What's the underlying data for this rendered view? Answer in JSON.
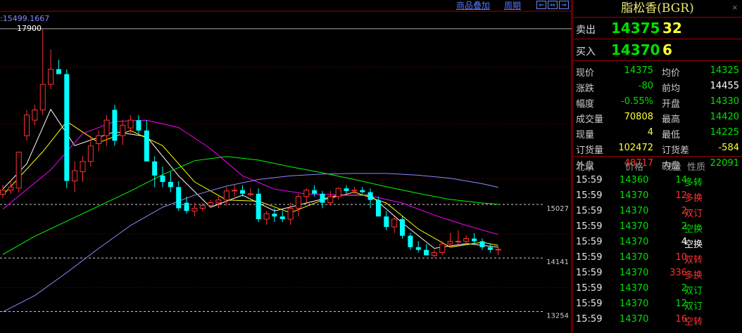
{
  "colors": {
    "up": "#ff3232",
    "down": "#00ffff",
    "gain": "#00e000",
    "loss": "#ff3232",
    "neutral": "#ffffff",
    "ma5": "#ffffff",
    "ma10": "#ffff00",
    "ma20": "#ff00ff",
    "ma40": "#00ff00",
    "ma60": "#8a8aff"
  },
  "toolbar": {
    "overlay_label": "商品叠加",
    "period_label": "周期",
    "nav_left": "⇐",
    "nav_mid": "⇔",
    "nav_right": "⇒"
  },
  "chart": {
    "top_readout": ":15499.1667",
    "high_label": "17900",
    "ref_lines": [
      {
        "label": "15027",
        "value": 15027
      },
      {
        "label": "14141",
        "value": 14141
      },
      {
        "label": "13254",
        "value": 13254
      }
    ]
  },
  "chart_data": {
    "type": "candlestick",
    "ylim": [
      12900,
      18200
    ],
    "candles": [
      {
        "o": 15195,
        "h": 15348,
        "l": 15127,
        "c": 15263
      },
      {
        "o": 15263,
        "h": 15432,
        "l": 15195,
        "c": 15314
      },
      {
        "o": 15297,
        "h": 15824,
        "l": 15229,
        "c": 15892
      },
      {
        "o": 16165,
        "h": 16591,
        "l": 16080,
        "c": 16506
      },
      {
        "o": 16421,
        "h": 16677,
        "l": 16336,
        "c": 16591
      },
      {
        "o": 16591,
        "h": 17934,
        "l": 16506,
        "c": 17014
      },
      {
        "o": 17014,
        "h": 17592,
        "l": 16932,
        "c": 17265
      },
      {
        "o": 17265,
        "h": 17421,
        "l": 17183,
        "c": 17183
      },
      {
        "o": 17183,
        "h": 17265,
        "l": 15297,
        "c": 15416
      },
      {
        "o": 15416,
        "h": 15739,
        "l": 15229,
        "c": 15586
      },
      {
        "o": 15568,
        "h": 15824,
        "l": 15399,
        "c": 15739
      },
      {
        "o": 15739,
        "h": 16165,
        "l": 15654,
        "c": 15995
      },
      {
        "o": 16033,
        "h": 16250,
        "l": 15908,
        "c": 16165
      },
      {
        "o": 16165,
        "h": 16506,
        "l": 15995,
        "c": 16421
      },
      {
        "o": 16592,
        "h": 16677,
        "l": 15995,
        "c": 16080
      },
      {
        "o": 16165,
        "h": 16421,
        "l": 16012,
        "c": 16336
      },
      {
        "o": 16293,
        "h": 16506,
        "l": 16210,
        "c": 16421
      },
      {
        "o": 16421,
        "h": 16506,
        "l": 16200,
        "c": 16250
      },
      {
        "o": 16250,
        "h": 16421,
        "l": 15739,
        "c": 15739
      },
      {
        "o": 15739,
        "h": 15824,
        "l": 15314,
        "c": 15505
      },
      {
        "o": 15505,
        "h": 15654,
        "l": 15314,
        "c": 15399
      },
      {
        "o": 15399,
        "h": 15568,
        "l": 15229,
        "c": 15314
      },
      {
        "o": 15314,
        "h": 15414,
        "l": 14919,
        "c": 14964
      },
      {
        "o": 15055,
        "h": 15158,
        "l": 14873,
        "c": 14919
      },
      {
        "o": 14919,
        "h": 15055,
        "l": 14828,
        "c": 14964
      },
      {
        "o": 14964,
        "h": 15055,
        "l": 14919,
        "c": 15010
      },
      {
        "o": 15010,
        "h": 15101,
        "l": 14964,
        "c": 15055
      },
      {
        "o": 15055,
        "h": 15158,
        "l": 14964,
        "c": 15101
      },
      {
        "o": 15101,
        "h": 15314,
        "l": 15010,
        "c": 15249
      },
      {
        "o": 15249,
        "h": 15345,
        "l": 15158,
        "c": 15263
      },
      {
        "o": 15263,
        "h": 15345,
        "l": 15158,
        "c": 15204
      },
      {
        "o": 15204,
        "h": 15292,
        "l": 15158,
        "c": 15204
      },
      {
        "o": 15204,
        "h": 15292,
        "l": 14736,
        "c": 14783
      },
      {
        "o": 14783,
        "h": 14919,
        "l": 14691,
        "c": 14873
      },
      {
        "o": 14873,
        "h": 14964,
        "l": 14736,
        "c": 14828
      },
      {
        "o": 14828,
        "h": 14919,
        "l": 14736,
        "c": 14783
      },
      {
        "o": 14783,
        "h": 15055,
        "l": 14691,
        "c": 14964
      },
      {
        "o": 14964,
        "h": 15204,
        "l": 14828,
        "c": 15158
      },
      {
        "o": 15158,
        "h": 15292,
        "l": 15055,
        "c": 15263
      },
      {
        "o": 15263,
        "h": 15345,
        "l": 15158,
        "c": 15204
      },
      {
        "o": 15204,
        "h": 15249,
        "l": 14964,
        "c": 15055
      },
      {
        "o": 15055,
        "h": 15249,
        "l": 15010,
        "c": 15158
      },
      {
        "o": 15158,
        "h": 15314,
        "l": 15101,
        "c": 15292
      },
      {
        "o": 15292,
        "h": 15345,
        "l": 15204,
        "c": 15249
      },
      {
        "o": 15249,
        "h": 15314,
        "l": 15204,
        "c": 15263
      },
      {
        "o": 15263,
        "h": 15314,
        "l": 15204,
        "c": 15230
      },
      {
        "o": 15230,
        "h": 15292,
        "l": 14964,
        "c": 15101
      },
      {
        "o": 15101,
        "h": 15158,
        "l": 14828,
        "c": 14828
      },
      {
        "o": 14828,
        "h": 14919,
        "l": 14600,
        "c": 14655
      },
      {
        "o": 14655,
        "h": 14828,
        "l": 14554,
        "c": 14783
      },
      {
        "o": 14783,
        "h": 14828,
        "l": 14463,
        "c": 14509
      },
      {
        "o": 14509,
        "h": 14554,
        "l": 14275,
        "c": 14320
      },
      {
        "o": 14320,
        "h": 14418,
        "l": 14230,
        "c": 14275
      },
      {
        "o": 14275,
        "h": 14373,
        "l": 14185,
        "c": 14185
      },
      {
        "o": 14185,
        "h": 14275,
        "l": 14141,
        "c": 14230
      },
      {
        "o": 14230,
        "h": 14418,
        "l": 14185,
        "c": 14373
      },
      {
        "o": 14373,
        "h": 14554,
        "l": 14320,
        "c": 14418
      },
      {
        "o": 14418,
        "h": 14600,
        "l": 14373,
        "c": 14418
      },
      {
        "o": 14418,
        "h": 14509,
        "l": 14373,
        "c": 14463
      },
      {
        "o": 14463,
        "h": 14554,
        "l": 14373,
        "c": 14418
      },
      {
        "o": 14418,
        "h": 14463,
        "l": 14275,
        "c": 14320
      },
      {
        "o": 14320,
        "h": 14373,
        "l": 14230,
        "c": 14275
      },
      {
        "o": 14275,
        "h": 14320,
        "l": 14185,
        "c": 14285
      }
    ],
    "ma": [
      {
        "name": "MA5",
        "color": "#ffffff",
        "values": [
          [
            0,
            15280
          ],
          [
            3,
            15700
          ],
          [
            6,
            16600
          ],
          [
            9,
            16000
          ],
          [
            14,
            16230
          ],
          [
            18,
            16150
          ],
          [
            22,
            15500
          ],
          [
            26,
            14980
          ],
          [
            30,
            15180
          ],
          [
            34,
            14920
          ],
          [
            38,
            15050
          ],
          [
            42,
            15180
          ],
          [
            46,
            15180
          ],
          [
            50,
            14720
          ],
          [
            54,
            14300
          ],
          [
            58,
            14380
          ],
          [
            62,
            14320
          ]
        ]
      },
      {
        "name": "MA10",
        "color": "#ffff00",
        "values": [
          [
            0,
            15180
          ],
          [
            5,
            15900
          ],
          [
            8,
            16400
          ],
          [
            12,
            16050
          ],
          [
            16,
            16250
          ],
          [
            20,
            16000
          ],
          [
            24,
            15400
          ],
          [
            28,
            15100
          ],
          [
            32,
            15080
          ],
          [
            36,
            14890
          ],
          [
            40,
            15100
          ],
          [
            44,
            15230
          ],
          [
            48,
            15050
          ],
          [
            52,
            14620
          ],
          [
            56,
            14320
          ],
          [
            60,
            14400
          ],
          [
            62,
            14350
          ]
        ]
      },
      {
        "name": "MA20",
        "color": "#ff00ff",
        "values": [
          [
            0,
            14950
          ],
          [
            6,
            15600
          ],
          [
            10,
            16200
          ],
          [
            14,
            16400
          ],
          [
            18,
            16420
          ],
          [
            22,
            16300
          ],
          [
            26,
            15950
          ],
          [
            30,
            15500
          ],
          [
            34,
            15280
          ],
          [
            38,
            15200
          ],
          [
            42,
            15190
          ],
          [
            46,
            15170
          ],
          [
            50,
            15050
          ],
          [
            54,
            14850
          ],
          [
            58,
            14680
          ],
          [
            62,
            14530
          ]
        ]
      },
      {
        "name": "MA40",
        "color": "#00ff00",
        "values": [
          [
            0,
            14200
          ],
          [
            4,
            14500
          ],
          [
            8,
            14750
          ],
          [
            12,
            15000
          ],
          [
            16,
            15250
          ],
          [
            20,
            15520
          ],
          [
            24,
            15750
          ],
          [
            28,
            15820
          ],
          [
            32,
            15760
          ],
          [
            36,
            15650
          ],
          [
            40,
            15550
          ],
          [
            44,
            15440
          ],
          [
            48,
            15320
          ],
          [
            52,
            15210
          ],
          [
            56,
            15110
          ],
          [
            60,
            15050
          ],
          [
            62,
            15030
          ]
        ]
      },
      {
        "name": "MA60",
        "color": "#8a8aff",
        "values": [
          [
            0,
            13250
          ],
          [
            4,
            13520
          ],
          [
            8,
            13900
          ],
          [
            12,
            14300
          ],
          [
            16,
            14680
          ],
          [
            20,
            14980
          ],
          [
            24,
            15180
          ],
          [
            28,
            15330
          ],
          [
            32,
            15440
          ],
          [
            36,
            15500
          ],
          [
            40,
            15530
          ],
          [
            44,
            15540
          ],
          [
            48,
            15540
          ],
          [
            52,
            15510
          ],
          [
            56,
            15460
          ],
          [
            60,
            15370
          ],
          [
            62,
            15310
          ]
        ]
      }
    ]
  },
  "panel": {
    "title": "脂松香(BGR)",
    "pin_icon": "×",
    "sell": {
      "label": "卖出",
      "price": "14375",
      "volume": "32"
    },
    "buy": {
      "label": "买入",
      "price": "14370",
      "volume": "6"
    },
    "stats": [
      {
        "l1": "现价",
        "v1": "14375",
        "c1": "#00e000",
        "l2": "均价",
        "v2": "14325",
        "c2": "#00e000"
      },
      {
        "l1": "涨跌",
        "v1": "-80",
        "c1": "#00e000",
        "l2": "前均",
        "v2": "14455",
        "c2": "#ffffff"
      },
      {
        "l1": "幅度",
        "v1": "-0.55%",
        "c1": "#00e000",
        "l2": "开盘",
        "v2": "14330",
        "c2": "#00e000"
      },
      {
        "l1": "成交量",
        "v1": "70808",
        "c1": "#ffff33",
        "l2": "最高",
        "v2": "14420",
        "c2": "#00e000"
      },
      {
        "l1": "现量",
        "v1": "4",
        "c1": "#ffff33",
        "l2": "最低",
        "v2": "14225",
        "c2": "#00e000"
      },
      {
        "l1": "订货量",
        "v1": "102472",
        "c1": "#ffff33",
        "l2": "订货差",
        "v2": "-584",
        "c2": "#ffff33"
      },
      {
        "l1": "外盘",
        "v1": "48717",
        "c1": "#ff3232",
        "l2": "内盘",
        "v2": "22091",
        "c2": "#00e000"
      }
    ],
    "ticks_header": {
      "time": "北京",
      "price": "价格",
      "volume": "现量",
      "type": "性质"
    },
    "ticks": [
      {
        "time": "15:59",
        "price": "14360",
        "volume": "14",
        "type": "多转",
        "color": "#00e000"
      },
      {
        "time": "15:59",
        "price": "14370",
        "volume": "12",
        "type": "多换",
        "color": "#ff3232"
      },
      {
        "time": "15:59",
        "price": "14370",
        "volume": "2",
        "type": "双订",
        "color": "#ff3232"
      },
      {
        "time": "15:59",
        "price": "14370",
        "volume": "2",
        "type": "空换",
        "color": "#00e000"
      },
      {
        "time": "15:59",
        "price": "14370",
        "volume": "4",
        "type": "空换",
        "color": "#ffffff"
      },
      {
        "time": "15:59",
        "price": "14370",
        "volume": "10",
        "type": "双转",
        "color": "#ff3232"
      },
      {
        "time": "15:59",
        "price": "14370",
        "volume": "336",
        "type": "多换",
        "color": "#ff3232"
      },
      {
        "time": "15:59",
        "price": "14370",
        "volume": "2",
        "type": "双订",
        "color": "#00e000"
      },
      {
        "time": "15:59",
        "price": "14370",
        "volume": "12",
        "type": "双订",
        "color": "#00e000"
      },
      {
        "time": "15:59",
        "price": "14370",
        "volume": "16",
        "type": "空转",
        "color": "#ff3232"
      }
    ]
  }
}
